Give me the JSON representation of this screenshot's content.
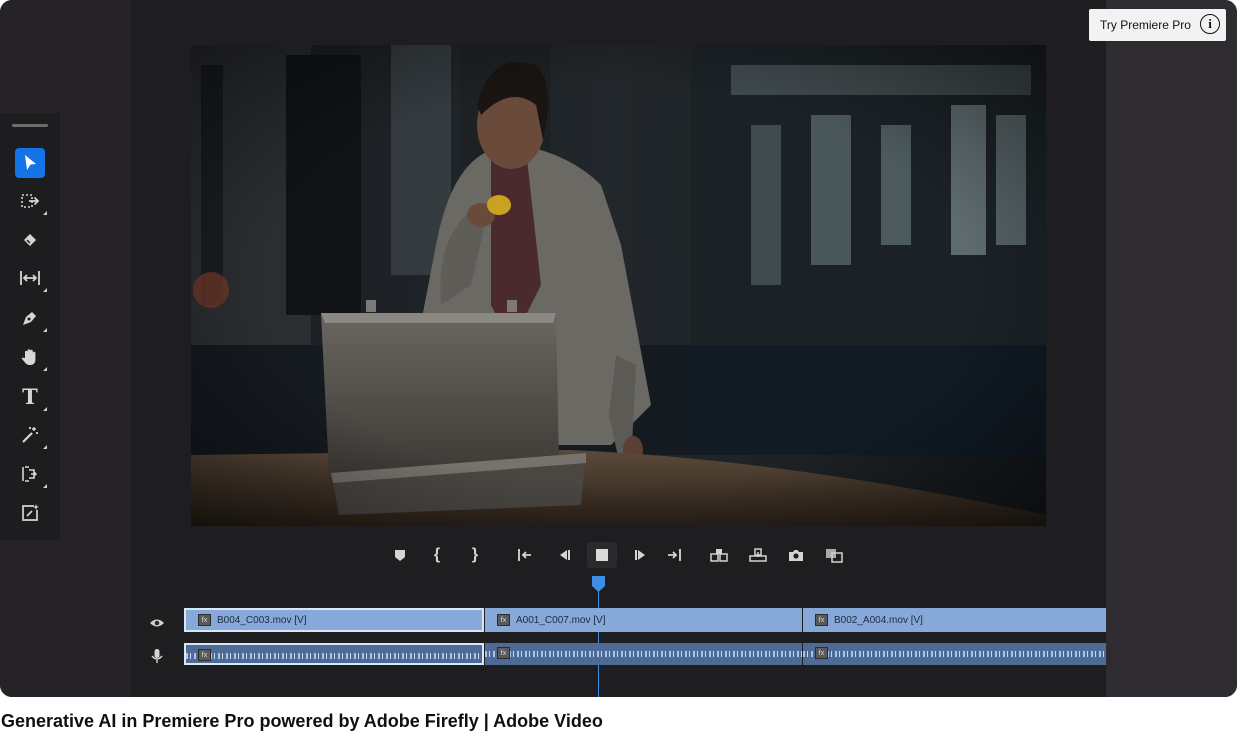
{
  "player": {
    "try_button_label": "Try Premiere Pro",
    "info_icon": "info-icon"
  },
  "toolbar": {
    "tools": [
      {
        "name": "selection-tool",
        "icon": "arrow-icon",
        "active": true
      },
      {
        "name": "track-select-tool",
        "icon": "track-select-icon",
        "active": false
      },
      {
        "name": "razor-tool",
        "icon": "razor-icon",
        "active": false
      },
      {
        "name": "ripple-edit-tool",
        "icon": "ripple-edit-icon",
        "active": false
      },
      {
        "name": "pen-tool",
        "icon": "pen-icon",
        "active": false
      },
      {
        "name": "hand-tool",
        "icon": "hand-icon",
        "active": false
      },
      {
        "name": "type-tool",
        "icon": "type-icon",
        "active": false
      },
      {
        "name": "magic-wand-tool",
        "icon": "wand-icon",
        "active": false
      },
      {
        "name": "slip-tool",
        "icon": "slip-icon",
        "active": false
      },
      {
        "name": "generative-extend-tool",
        "icon": "generative-extend-icon",
        "active": false
      }
    ],
    "type_tool_glyph": "T"
  },
  "transport": {
    "buttons": [
      "add-marker",
      "mark-in",
      "mark-out",
      "go-to-in",
      "step-back",
      "stop",
      "step-forward",
      "go-to-out",
      "insert",
      "overwrite",
      "export-frame",
      "compare-view"
    ],
    "mark_in_glyph": "{",
    "mark_out_glyph": "}"
  },
  "timeline": {
    "video_clips": [
      {
        "label": "B004_C003.mov [V]",
        "selected": true
      },
      {
        "label": "A001_C007.mov [V]",
        "selected": false
      },
      {
        "label": "B002_A004.mov [V]",
        "selected": false
      }
    ],
    "fx_glyph": "fx",
    "accent_color": "#3d8ee6",
    "clip_color": "#86a9d9"
  },
  "caption": "Generative AI in Premiere Pro powered by Adobe Firefly | Adobe Video"
}
